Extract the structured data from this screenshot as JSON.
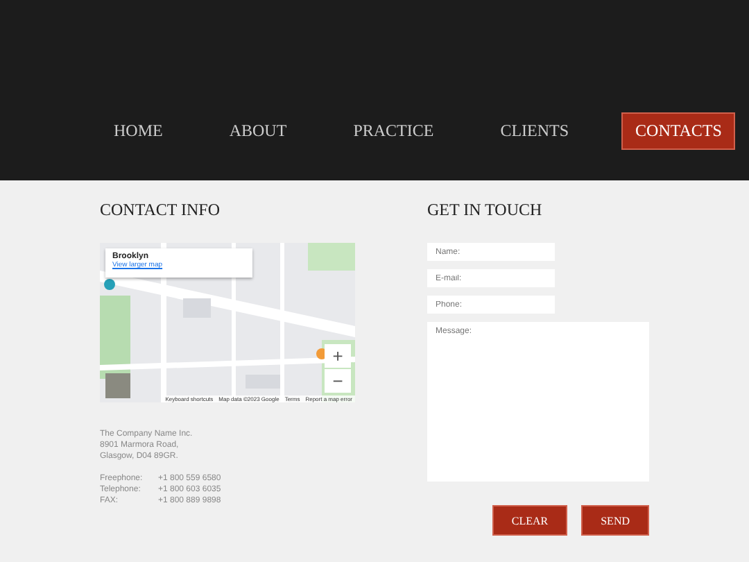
{
  "nav": [
    {
      "label": "HOME",
      "selected": false
    },
    {
      "label": "ABOUT",
      "selected": false
    },
    {
      "label": "PRACTICE",
      "selected": false
    },
    {
      "label": "CLIENTS",
      "selected": false
    },
    {
      "label": "CONTACTS",
      "selected": true
    }
  ],
  "contact_info": {
    "title": "CONTACT INFO",
    "map": {
      "kind": "picture",
      "place": "Brooklyn",
      "link": "View larger map",
      "zoom_in": "+",
      "zoom_out": "−",
      "attribution": [
        "Keyboard shortcuts",
        "Map data ©2023 Google",
        "Terms",
        "Report a map error"
      ]
    },
    "address": [
      "The Company Name Inc.",
      "8901 Marmora Road,",
      "Glasgow, D04 89GR."
    ],
    "phones": [
      {
        "label": "Freephone:",
        "value": "+1 800 559 6580"
      },
      {
        "label": "Telephone:",
        "value": "+1 800 603 6035"
      },
      {
        "label": "FAX:",
        "value": "+1 800 889 9898"
      }
    ]
  },
  "get_in_touch": {
    "title": "GET IN TOUCH",
    "fields": [
      {
        "kind": "input",
        "placeholder": "Name:"
      },
      {
        "kind": "input",
        "placeholder": "E-mail:"
      },
      {
        "kind": "input",
        "placeholder": "Phone:"
      },
      {
        "kind": "textarea",
        "placeholder": "Message:"
      }
    ],
    "buttons": [
      "CLEAR",
      "SEND"
    ]
  }
}
